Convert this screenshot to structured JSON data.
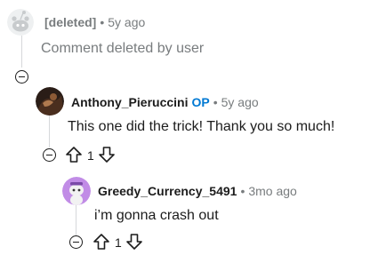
{
  "comments": [
    {
      "author": "[deleted]",
      "separator": "•",
      "time": "5y ago",
      "body": "Comment deleted by user",
      "avatar_icon": "deleted-user-icon"
    },
    {
      "author": "Anthony_Pieruccini",
      "op_badge": "OP",
      "separator": "•",
      "time": "5y ago",
      "body": "This one did the trick! Thank you so much!",
      "votes": "1",
      "avatar_icon": "user-avatar-photo"
    },
    {
      "author": "Greedy_Currency_5491",
      "separator": "•",
      "time": "3mo ago",
      "body": "i’m gonna crash out",
      "votes": "1",
      "avatar_icon": "snoo-avatar-icon"
    }
  ],
  "colors": {
    "op": "#0079d3",
    "muted": "#787c7e",
    "thread_line": "#d6d8da",
    "snoo_avatar_bg": "#c18ce6"
  }
}
